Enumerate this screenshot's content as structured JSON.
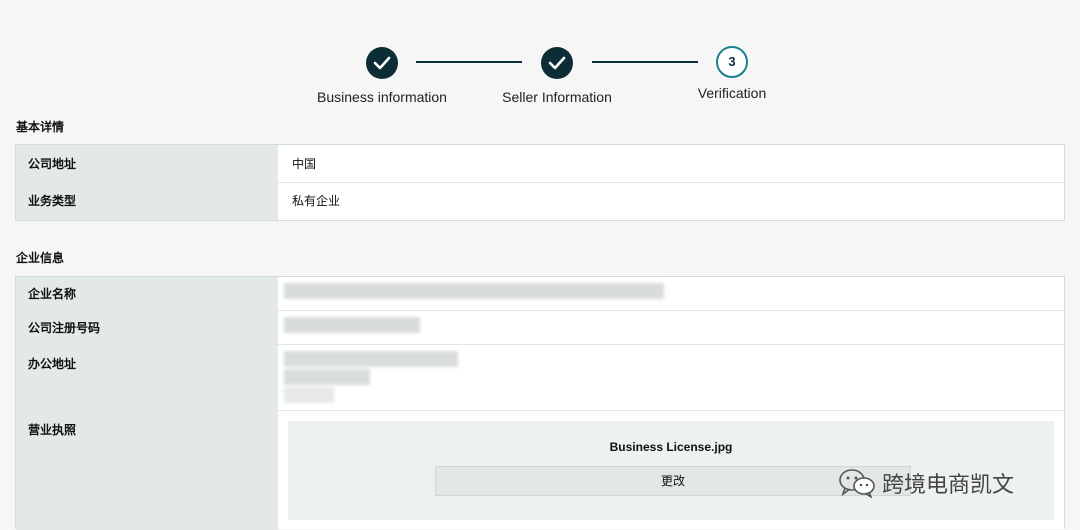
{
  "stepper": {
    "steps": [
      {
        "label": "Business information",
        "status": "complete"
      },
      {
        "label": "Seller Information",
        "status": "complete"
      },
      {
        "label": "Verification",
        "status": "current",
        "number": "3"
      }
    ]
  },
  "basic_details": {
    "title": "基本详情",
    "rows": [
      {
        "key": "公司地址",
        "value": "中国"
      },
      {
        "key": "业务类型",
        "value": "私有企业"
      }
    ]
  },
  "company_info": {
    "title": "企业信息",
    "rows": [
      {
        "key": "企业名称"
      },
      {
        "key": "公司注册号码"
      },
      {
        "key": "办公地址"
      },
      {
        "key": "营业执照"
      }
    ],
    "license": {
      "filename": "Business License.jpg",
      "change_label": "更改"
    }
  },
  "watermark": {
    "text": "跨境电商凯文"
  },
  "colors": {
    "accent": "#0d2d36",
    "current_ring": "#1b7f8e",
    "key_bg": "#e3e8e9"
  }
}
